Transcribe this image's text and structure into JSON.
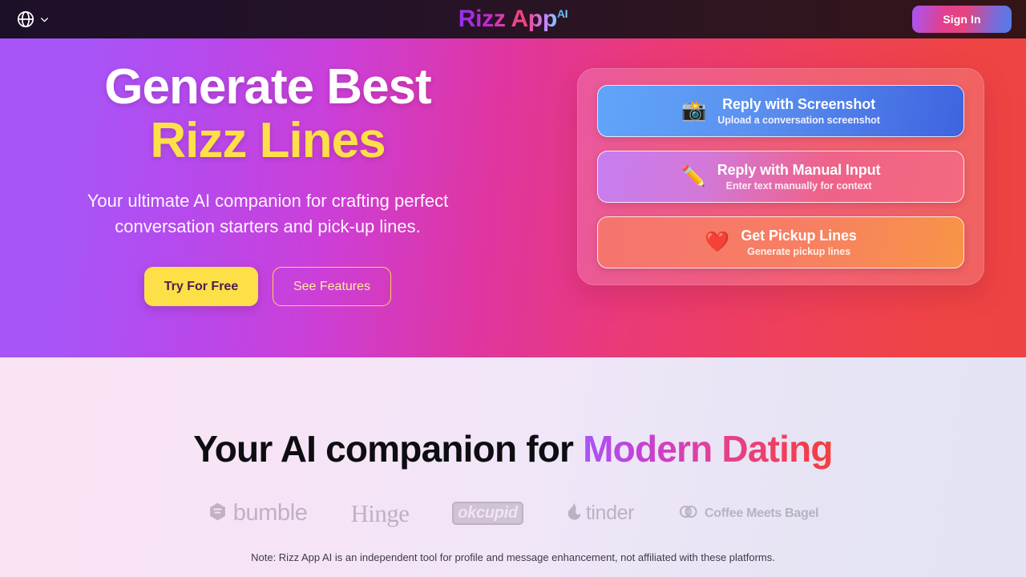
{
  "header": {
    "language_switch": {
      "icon": "globe-icon",
      "chevron": "chevron-down-icon"
    },
    "brand": {
      "name": "Rizz App",
      "superscript": "AI"
    },
    "sign_in_label": "Sign In"
  },
  "hero": {
    "title_line1": "Generate Best",
    "title_line2": "Rizz Lines",
    "subtitle": "Your ultimate AI companion for crafting perfect conversation starters and pick-up lines.",
    "primary_cta": "Try For Free",
    "secondary_cta": "See Features",
    "cards": [
      {
        "icon": "camera-with-flash-icon",
        "emoji": "📸",
        "title": "Reply with Screenshot",
        "desc": "Upload a conversation screenshot"
      },
      {
        "icon": "pencil-icon",
        "emoji": "✏️",
        "title": "Reply with Manual Input",
        "desc": "Enter text manually for context"
      },
      {
        "icon": "red-heart-icon",
        "emoji": "❤️",
        "title": "Get Pickup Lines",
        "desc": "Generate pickup lines"
      }
    ]
  },
  "lower": {
    "section_title_plain": "Your AI companion for ",
    "section_title_accent": "Modern Dating",
    "logos": [
      {
        "name": "bumble",
        "label": "bumble"
      },
      {
        "name": "hinge",
        "label": "Hinge"
      },
      {
        "name": "okcupid",
        "label": "okcupid"
      },
      {
        "name": "tinder",
        "label": "tinder"
      },
      {
        "name": "coffee-meets-bagel",
        "label": "Coffee Meets Bagel"
      }
    ],
    "disclaimer": "Note: Rizz App AI is an independent tool for profile and message enhancement, not affiliated with these platforms."
  },
  "colors": {
    "hero_gradient_start": "#a855f7",
    "hero_gradient_mid": "#e0359f",
    "hero_gradient_end": "#ef4444",
    "accent_yellow": "#fde047",
    "header_bg": "#1c1028",
    "card_blue": "#4f7ee6",
    "card_purple_pink": "#ef6289",
    "card_red_orange": "#f89447"
  }
}
